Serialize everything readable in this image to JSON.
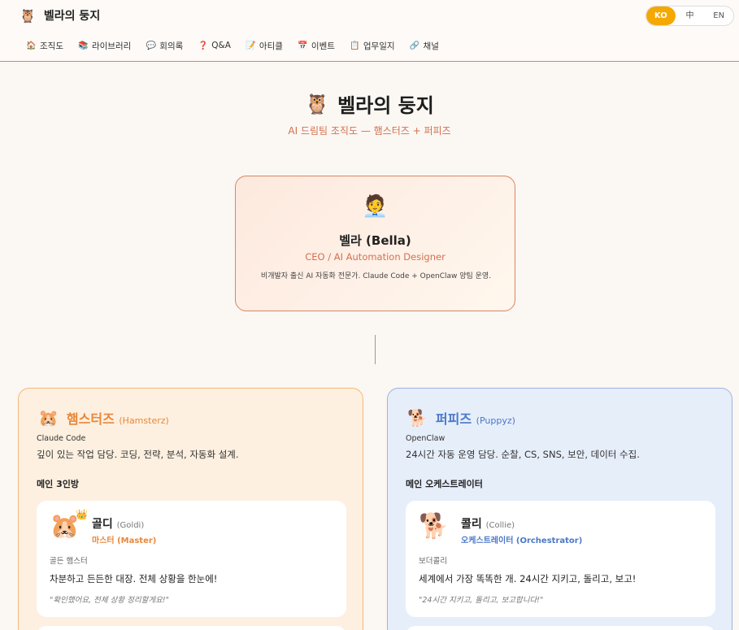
{
  "header": {
    "logo_icon": "owl-with-goggles-icon",
    "title": "벨라의 둥지",
    "languages": [
      "KO",
      "中",
      "EN"
    ],
    "active_language": "KO",
    "nav": [
      {
        "icon": "🏠",
        "label": "조직도"
      },
      {
        "icon": "📚",
        "label": "라이브러리"
      },
      {
        "icon": "💬",
        "label": "회의록"
      },
      {
        "icon": "❓",
        "label": "Q&A"
      },
      {
        "icon": "📝",
        "label": "아티클"
      },
      {
        "icon": "📅",
        "label": "이벤트"
      },
      {
        "icon": "📋",
        "label": "업무일지"
      },
      {
        "icon": "🔗",
        "label": "채널"
      }
    ]
  },
  "hero": {
    "title": "벨라의 둥지",
    "subtitle": "AI 드림팀 조직도 — 햄스터즈 + 퍼피즈"
  },
  "ceo": {
    "emoji": "🧑‍💼",
    "name": "벨라 (Bella)",
    "role": "CEO / AI Automation Designer",
    "description": "비개발자 출신 AI 자동화 전문가. Claude Code + OpenClaw 양팀 운영."
  },
  "teams": [
    {
      "emoji": "🐹",
      "name": "햄스터즈",
      "name_en": "(Hamsterz)",
      "tool": "Claude Code",
      "description": "깊이 있는 작업 담당. 코딩, 전략, 분석, 자동화 설계.",
      "section": "메인 3인방",
      "member": {
        "avatar": "🐹",
        "badge": "👑",
        "name": "골디",
        "name_en": "(Goldi)",
        "role": "마스터 (Master)",
        "breed": "골든 햄스터",
        "description": "차분하고 든든한 대장. 전체 상황을 한눈에!",
        "quote": "\"확인했어요, 전체 상황 정리할게요!\""
      }
    },
    {
      "emoji": "🐕",
      "name": "퍼피즈",
      "name_en": "(Puppyz)",
      "tool": "OpenClaw",
      "description": "24시간 자동 운영 담당. 순찰, CS, SNS, 보안, 데이터 수집.",
      "section": "메인 오케스트레이터",
      "member": {
        "avatar": "🐕",
        "badge": "",
        "name": "콜리",
        "name_en": "(Collie)",
        "role": "오케스트레이터 (Orchestrator)",
        "breed": "보더콜리",
        "description": "세계에서 가장 똑똑한 개. 24시간 지키고, 돌리고, 보고!",
        "quote": "\"24시간 지키고, 돌리고, 보고합니다!\""
      }
    }
  ],
  "colors": {
    "accent": "#d4704f",
    "hamster": "#e8873a",
    "puppy": "#4a78c8",
    "lang_active": "#f4a800"
  }
}
